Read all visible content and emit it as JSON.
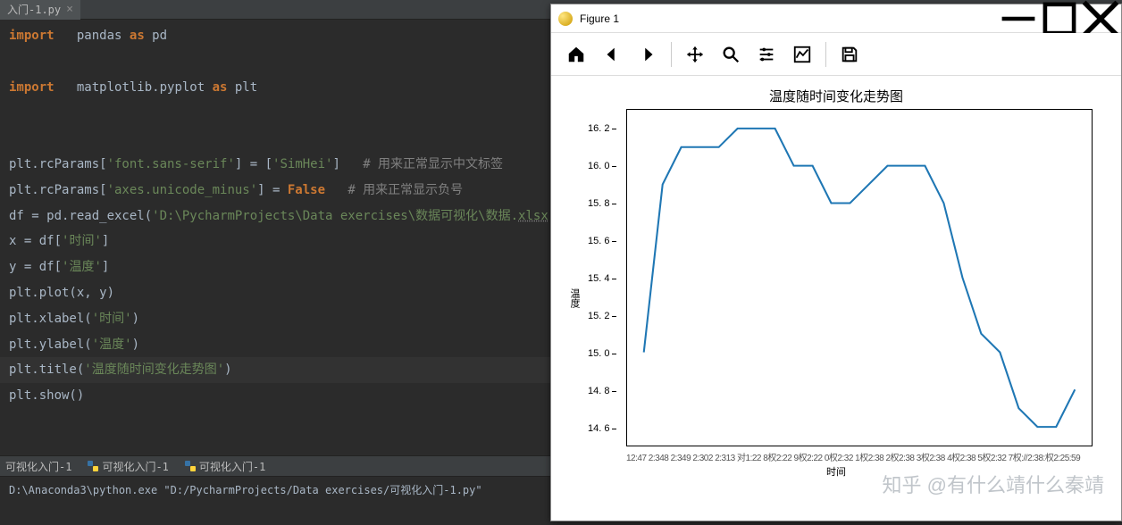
{
  "editor": {
    "tab_name": "入门-1.py",
    "code_lines": [
      {
        "t": "import",
        "sp": "   ",
        "rest": "pandas ",
        "kw2": "as",
        "tail": " pd"
      },
      {
        "blank": true
      },
      {
        "t": "import",
        "sp": "   ",
        "rest": "matplotlib.pyplot ",
        "kw2": "as",
        "tail": " plt"
      },
      {
        "blank": true
      },
      {
        "blank": true
      },
      {
        "raw": "plt.rcParams[",
        "s1": "'font.sans-serif'",
        "mid": "] = [",
        "s2": "'SimHei'",
        "end": "]   ",
        "cmt": "# 用来正常显示中文标签"
      },
      {
        "raw": "plt.rcParams[",
        "s1": "'axes.unicode_minus'",
        "mid": "] = ",
        "bool": "False",
        "end": "   ",
        "cmt": "# 用来正常显示负号"
      },
      {
        "raw": "df = pd.read_excel(",
        "s1": "'D:\\PycharmProjects\\Data exercises\\数据可视化\\数据.",
        "udl": "xlsx",
        "s1b": "'",
        "end": ")"
      },
      {
        "raw": "x = df[",
        "s1": "'时间'",
        "end": "]"
      },
      {
        "raw": "y = df[",
        "s1": "'温度'",
        "end": "]"
      },
      {
        "raw": "plt.plot(x, y)"
      },
      {
        "raw": "plt.xlabel(",
        "s1": "'时间'",
        "end": ")"
      },
      {
        "raw": "plt.ylabel(",
        "s1": "'温度'",
        "end": ")"
      },
      {
        "raw": "plt.title(",
        "s1": "'温度随时间变化走势图'",
        "end": ")",
        "hl": true
      },
      {
        "raw": "plt.show()"
      }
    ]
  },
  "run_tabs": [
    "可视化入门-1",
    "可视化入门-1",
    "可视化入门-1"
  ],
  "console_line": "D:\\Anaconda3\\python.exe \"D:/PycharmProjects/Data exercises/可视化入门-1.py\"",
  "figure": {
    "window_title": "Figure 1",
    "toolbar_items": [
      "home",
      "back",
      "forward",
      "sep",
      "pan",
      "zoom",
      "configure",
      "subplots",
      "sep",
      "save"
    ]
  },
  "chart_data": {
    "type": "line",
    "title": "温度随时间变化走势图",
    "xlabel": "时间",
    "ylabel": "温度",
    "ylim": [
      14.5,
      16.3
    ],
    "yticks": [
      14.6,
      14.8,
      15.0,
      15.2,
      15.4,
      15.6,
      15.8,
      16.0,
      16.2
    ],
    "xticks_raw": "12:47 2:348 2:349 2:302 2:313 对1:22 8权2:22 9权2:22 0权2:32 1权2:38 2权2:38 3权2:38 4权2:38 5权2:32 7权://2:38:权2:25:59",
    "x_index": [
      0,
      1,
      2,
      3,
      4,
      5,
      6,
      7,
      8,
      9,
      10,
      11,
      12,
      13,
      14,
      15,
      16,
      17,
      18,
      19,
      20,
      21,
      22,
      23
    ],
    "values": [
      15.0,
      15.9,
      16.1,
      16.1,
      16.1,
      16.2,
      16.2,
      16.2,
      16.0,
      16.0,
      15.8,
      15.8,
      15.9,
      16.0,
      16.0,
      16.0,
      15.8,
      15.4,
      15.1,
      15.0,
      14.7,
      14.6,
      14.6,
      14.8
    ]
  },
  "watermark": "知乎 @有什么靖什么秦靖"
}
